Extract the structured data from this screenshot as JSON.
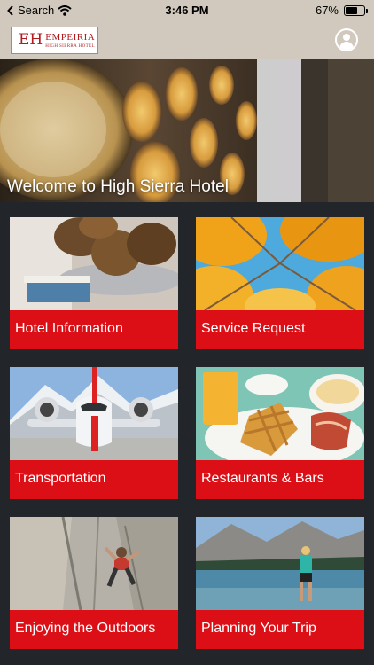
{
  "status_bar": {
    "back_label": "Search",
    "time": "3:46 PM",
    "battery": "67%",
    "battery_level": 0.67
  },
  "header": {
    "logo_mark": "EH",
    "logo_name": "EMPEIRIA",
    "logo_sub": "HIGH SIERRA HOTEL"
  },
  "hero": {
    "caption": "Welcome to High Sierra Hotel"
  },
  "tiles": [
    {
      "label": "Hotel Information"
    },
    {
      "label": "Service Request"
    },
    {
      "label": "Transportation"
    },
    {
      "label": "Restaurants & Bars"
    },
    {
      "label": "Enjoying the Outdoors"
    },
    {
      "label": "Planning Your Trip"
    }
  ],
  "colors": {
    "header_bg": "#d1c9bd",
    "accent_red": "#db0f15",
    "page_bg": "#22252a",
    "logo_red": "#b01c20"
  }
}
